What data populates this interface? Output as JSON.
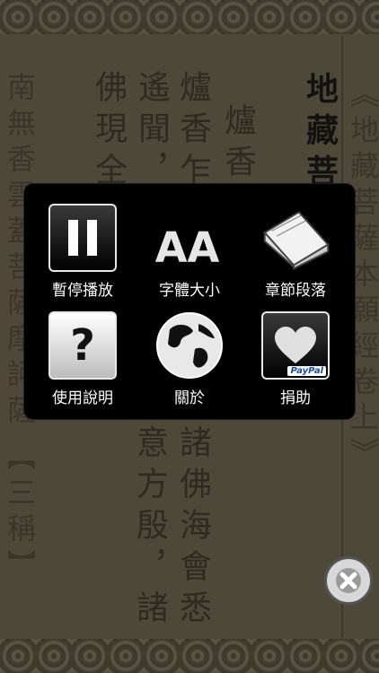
{
  "scripture": {
    "right_title": "《地藏菩薩本願經卷上》",
    "col_title": "地藏菩薩",
    "col1": "爐香讚",
    "col2": "爐香乍熱",
    "col3": "遙聞，隨",
    "col4": "佛現全身",
    "col5_bottom": "諸佛海會悉",
    "col6_bottom": "意方殷，諸",
    "left1": "南無香雲蓋菩薩摩訶薩",
    "left2": "【三稱】"
  },
  "menu": {
    "pause_label": "暫停播放",
    "font_size_label": "字體大小",
    "font_size_icon_text": "AA",
    "chapters_label": "章節段落",
    "help_label": "使用說明",
    "help_icon_text": "?",
    "about_label": "關於",
    "donate_label": "捐助",
    "paypal_text": "PayPal"
  },
  "icons": {
    "pause": "pause-icon",
    "font_size": "font-size-icon",
    "chapters": "book-icon",
    "help": "help-icon",
    "about": "globe-icon",
    "donate": "heart-icon",
    "close": "close-icon"
  }
}
